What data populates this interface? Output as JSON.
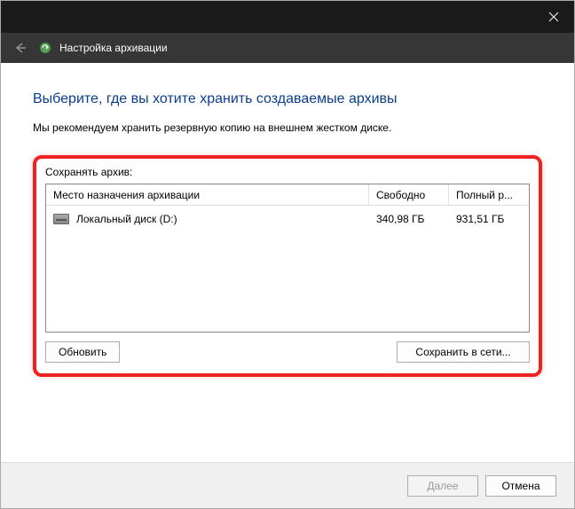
{
  "titlebar": {
    "close_char": "✕"
  },
  "header": {
    "title": "Настройка архивации"
  },
  "main": {
    "heading": "Выберите, где вы хотите хранить создаваемые архивы",
    "subheading": "Мы рекомендуем хранить резервную копию на внешнем жестком диске.",
    "section_label": "Сохранять архив:",
    "columns": {
      "dest": "Место назначения архивации",
      "free": "Свободно",
      "size": "Полный р..."
    },
    "rows": [
      {
        "name": "Локальный диск (D:)",
        "free": "340,98 ГБ",
        "size": "931,51 ГБ"
      }
    ],
    "buttons": {
      "refresh": "Обновить",
      "save_network": "Сохранить в сети..."
    }
  },
  "footer": {
    "next": "Далее",
    "cancel": "Отмена"
  }
}
